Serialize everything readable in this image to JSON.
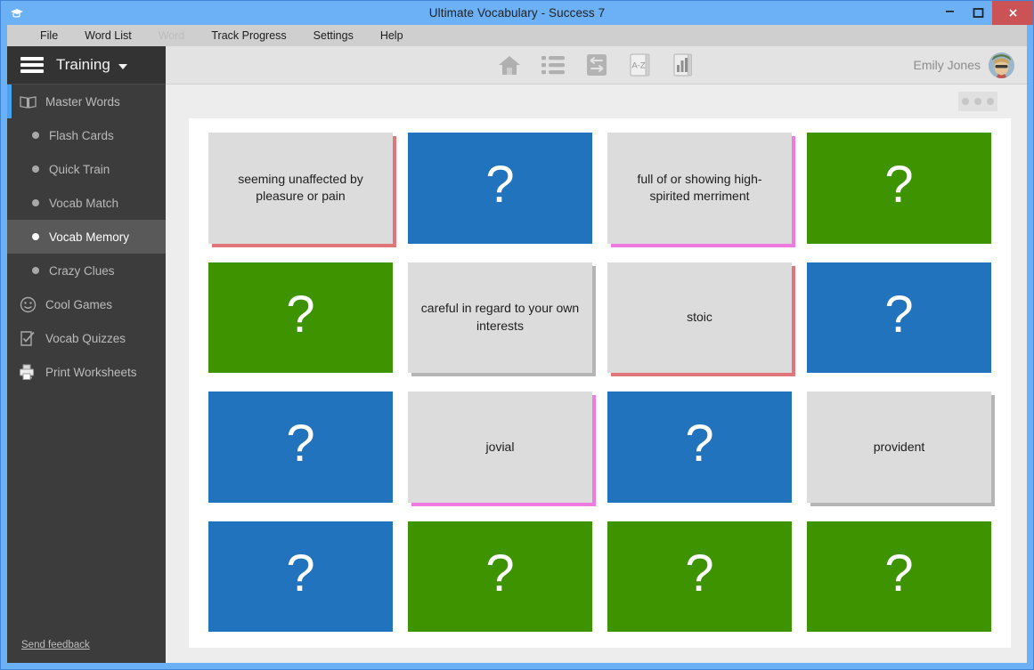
{
  "window": {
    "title": "Ultimate Vocabulary - Success 7",
    "app_icon": "graduation-cap-icon",
    "controls": {
      "minimize": "–",
      "maximize": "❐",
      "close": "✕"
    },
    "accent_blue": "#6cb0f5",
    "close_red": "#cc5355"
  },
  "menubar": {
    "items": [
      {
        "label": "File",
        "disabled": false
      },
      {
        "label": "Word List",
        "disabled": false
      },
      {
        "label": "Word",
        "disabled": true
      },
      {
        "label": "Track Progress",
        "disabled": false
      },
      {
        "label": "Settings",
        "disabled": false
      },
      {
        "label": "Help",
        "disabled": false
      }
    ]
  },
  "sidebar": {
    "title": "Training",
    "menu_icon": "hamburger-icon",
    "caret_icon": "chevron-down-icon",
    "background": "#3c3c3c",
    "active_background": "#595959",
    "highlight_bar": "#4aa3f0",
    "items": [
      {
        "label": "Master Words",
        "icon": "book-icon",
        "type": "section",
        "active": false,
        "highlight": true
      },
      {
        "label": "Flash Cards",
        "icon": "bullet-icon",
        "type": "sub",
        "active": false
      },
      {
        "label": "Quick Train",
        "icon": "bullet-icon",
        "type": "sub",
        "active": false
      },
      {
        "label": "Vocab Match",
        "icon": "bullet-icon",
        "type": "sub",
        "active": false
      },
      {
        "label": "Vocab Memory",
        "icon": "bullet-icon",
        "type": "sub",
        "active": true
      },
      {
        "label": "Crazy Clues",
        "icon": "bullet-icon",
        "type": "sub",
        "active": false
      },
      {
        "label": "Cool Games",
        "icon": "smiley-icon",
        "type": "section",
        "active": false
      },
      {
        "label": "Vocab Quizzes",
        "icon": "checklist-icon",
        "type": "section",
        "active": false
      },
      {
        "label": "Print Worksheets",
        "icon": "printer-icon",
        "type": "section",
        "active": false
      }
    ],
    "feedback_link": "Send feedback"
  },
  "toolbar": {
    "icons": [
      {
        "name": "home-icon",
        "label": "Home"
      },
      {
        "name": "list-icon",
        "label": "Word List"
      },
      {
        "name": "swap-arrows-icon",
        "label": "Swap"
      },
      {
        "name": "a-z-dictionary-icon",
        "label": "A-Z"
      },
      {
        "name": "bar-chart-icon",
        "label": "Progress"
      }
    ],
    "az_text": "A-Z"
  },
  "user": {
    "name": "Emily Jones",
    "avatar": "user-avatar"
  },
  "content": {
    "options_button": "more-options-button",
    "panel_background": "#ffffff",
    "colors": {
      "blue_back": "#2173bd",
      "green_back": "#3e9400",
      "face": "#dcdcdc",
      "shadow_red": "#e0767a",
      "shadow_pink": "#f07be0",
      "shadow_gray": "#b5b5b5"
    },
    "question_glyph": "?",
    "cards": [
      {
        "id": 1,
        "state": "face-up",
        "text": "seeming unaffected by pleasure or pain",
        "shadow": "red"
      },
      {
        "id": 2,
        "state": "face-down",
        "color": "blue"
      },
      {
        "id": 3,
        "state": "face-up",
        "text": "full of or showing high-spirited merriment",
        "shadow": "pink"
      },
      {
        "id": 4,
        "state": "face-down",
        "color": "green"
      },
      {
        "id": 5,
        "state": "face-down",
        "color": "green"
      },
      {
        "id": 6,
        "state": "face-up",
        "text": "careful in regard to your own interests",
        "shadow": "gray"
      },
      {
        "id": 7,
        "state": "face-up",
        "text": "stoic",
        "shadow": "red"
      },
      {
        "id": 8,
        "state": "face-down",
        "color": "blue"
      },
      {
        "id": 9,
        "state": "face-down",
        "color": "blue"
      },
      {
        "id": 10,
        "state": "face-up",
        "text": "jovial",
        "shadow": "pink"
      },
      {
        "id": 11,
        "state": "face-down",
        "color": "blue"
      },
      {
        "id": 12,
        "state": "face-up",
        "text": "provident",
        "shadow": "gray"
      },
      {
        "id": 13,
        "state": "face-down",
        "color": "blue"
      },
      {
        "id": 14,
        "state": "face-down",
        "color": "green"
      },
      {
        "id": 15,
        "state": "face-down",
        "color": "green"
      },
      {
        "id": 16,
        "state": "face-down",
        "color": "green"
      }
    ]
  }
}
